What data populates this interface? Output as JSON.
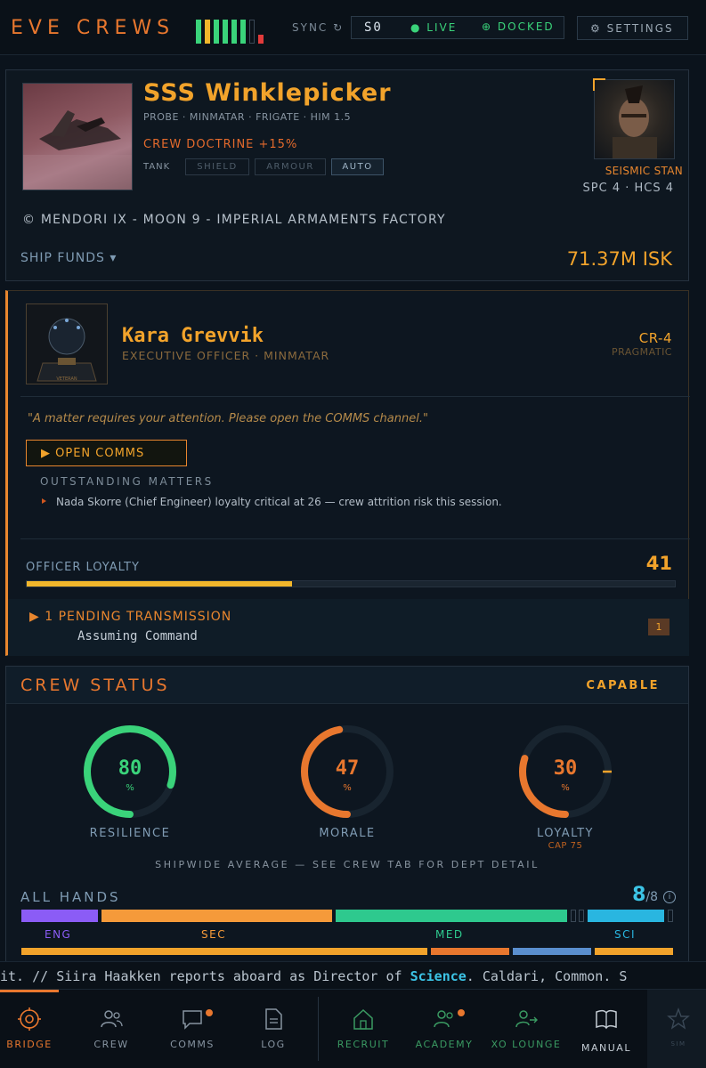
{
  "header": {
    "logo": "EVE CREWS",
    "sync_label": "SYNC ↻",
    "sync_value": "S0",
    "live_label": "LIVE",
    "docked_label": "DOCKED",
    "settings_label": "SETTINGS",
    "signal_colors": [
      "#3ad37a",
      "#f2b62b",
      "#3ad37a",
      "#3ad37a",
      "#3ad37a",
      "#3ad37a",
      "#2b3a48",
      "#e23b3b"
    ]
  },
  "ship": {
    "name": "SSS Winklepicker",
    "subtitle": "PROBE · MINMATAR · FRIGATE · HIM 1.5",
    "doctrine": "CREW DOCTRINE +15%",
    "tank_label": "TANK",
    "tank_options": [
      "SHIELD",
      "ARMOUR",
      "AUTO"
    ],
    "tank_selected": "AUTO",
    "captain_name": "SEISMIC STAN",
    "captain_skills": "SPC 4 · HCS 4",
    "location": "©  MENDORI IX - MOON 9 - IMPERIAL ARMAMENTS FACTORY",
    "funds_label": "SHIP FUNDS ▾",
    "funds_value": "71.37M ISK"
  },
  "officer": {
    "name": "Kara Grevvik",
    "role": "EXECUTIVE OFFICER · MINMATAR",
    "rating": "CR-4",
    "disposition": "PRAGMATIC",
    "portrait_caption": "VETERAN",
    "quote": "\"A matter requires your attention. Please open the COMMS channel.\"",
    "open_comms_label": "▶ OPEN COMMS",
    "outstanding_label": "OUTSTANDING MATTERS",
    "matters": [
      "Nada Skorre (Chief Engineer) loyalty critical at 26 — crew attrition risk this session."
    ],
    "loyalty_label": "OFFICER LOYALTY",
    "loyalty_value": "41",
    "loyalty_fraction": 0.41,
    "pending_label": "▶ 1 PENDING TRANSMISSION",
    "pending_title": "Assuming Command",
    "pending_count": "1"
  },
  "crew_status": {
    "title": "CREW STATUS",
    "rating": "CAPABLE",
    "gauges": [
      {
        "label": "RESILIENCE",
        "value": "80",
        "unit": "%",
        "fraction": 0.8,
        "color": "#3ad37a",
        "cap": ""
      },
      {
        "label": "MORALE",
        "value": "47",
        "unit": "%",
        "fraction": 0.47,
        "color": "#e8772e",
        "cap": ""
      },
      {
        "label": "LOYALTY",
        "value": "30",
        "unit": "%",
        "fraction": 0.3,
        "color": "#e8772e",
        "cap": "CAP 75",
        "cap_fraction": 0.75
      }
    ],
    "shipwide_note": "SHIPWIDE AVERAGE — SEE CREW TAB FOR DEPT DETAIL",
    "all_hands_label": "ALL HANDS",
    "hands_current": "8",
    "hands_total": "/8",
    "departments": [
      {
        "label": "ENG",
        "color": "#8b5cf6"
      },
      {
        "label": "SEC",
        "color": "#f59a3a"
      },
      {
        "label": "MED",
        "color": "#2ec98e"
      },
      {
        "label": "SCI",
        "color": "#29b6e0"
      }
    ]
  },
  "ticker": {
    "prefix": "it. // Siira Haakken reports aboard as Director of ",
    "highlight": "Science",
    "suffix": ". Caldari, Common. S"
  },
  "nav": {
    "items": [
      {
        "label": "BRIDGE",
        "icon": "bridge-icon",
        "active": true
      },
      {
        "label": "CREW",
        "icon": "crew-icon"
      },
      {
        "label": "COMMS",
        "icon": "comms-icon"
      },
      {
        "label": "LOG",
        "icon": "log-icon"
      },
      {
        "label": "RECRUIT",
        "icon": "recruit-icon"
      },
      {
        "label": "ACADEMY",
        "icon": "academy-icon"
      },
      {
        "label": "XO LOUNGE",
        "icon": "xo-lounge-icon"
      },
      {
        "label": "MANUAL",
        "icon": "manual-icon"
      },
      {
        "label": "SIM",
        "icon": "star-icon"
      }
    ]
  }
}
